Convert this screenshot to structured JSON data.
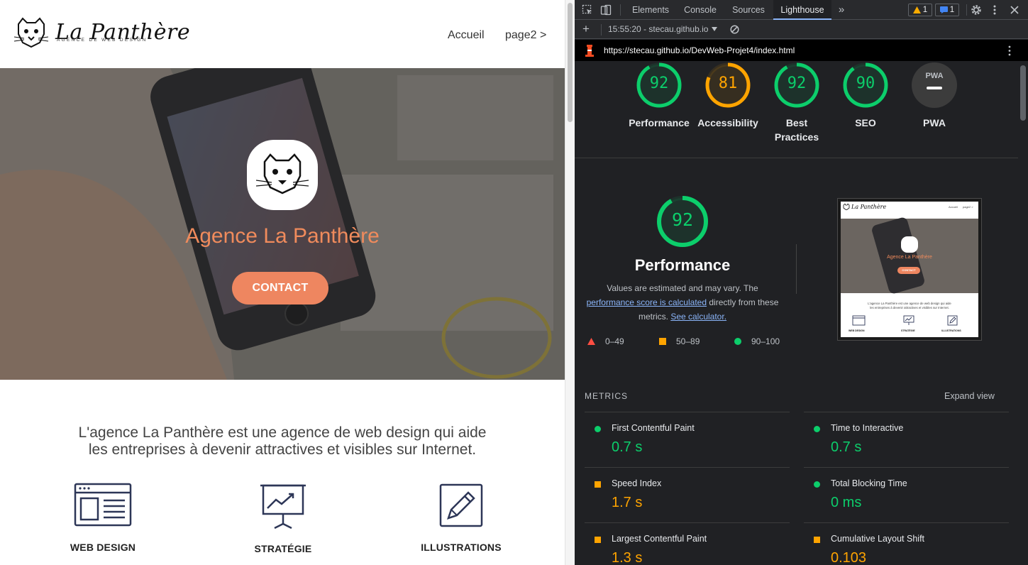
{
  "site": {
    "logo_name": "La Panthère",
    "logo_tagline": "AGENCE DE WEB DESIGN",
    "nav": [
      "Accueil",
      "page2 >"
    ],
    "hero_title": "Agence La Panthère",
    "contact_label": "CONTACT",
    "intro_line1": "L'agence La Panthère est une agence de web design qui aide",
    "intro_line2": "les entreprises à devenir attractives et visibles sur Internet.",
    "services": [
      "WEB DESIGN",
      "STRATÉGIE",
      "ILLUSTRATIONS"
    ]
  },
  "devtools": {
    "tabs": [
      "Elements",
      "Console",
      "Sources",
      "Lighthouse"
    ],
    "more_tabs": "»",
    "warning_count": "1",
    "message_count": "1",
    "toolbar_add": "+",
    "report_label": "15:55:20 - stecau.github.io",
    "report_url": "https://stecau.github.io/DevWeb-Projet4/index.html",
    "gauges": [
      {
        "score": "92",
        "label": "Performance",
        "level": 0.92,
        "status": "pass"
      },
      {
        "score": "81",
        "label": "Accessibility",
        "level": 0.81,
        "status": "average"
      },
      {
        "score": "92",
        "label": "Best Practices",
        "level": 0.92,
        "status": "pass"
      },
      {
        "score": "90",
        "label": "SEO",
        "level": 0.9,
        "status": "pass"
      },
      {
        "score": "",
        "label": "PWA",
        "level": 0,
        "status": "na",
        "badge": "PWA"
      }
    ],
    "perf_score": "92",
    "perf_level": 0.92,
    "perf_title": "Performance",
    "perf_desc_1": "Values are estimated and may vary. The",
    "perf_desc_link1": "performance score is calculated",
    "perf_desc_2": "directly from these",
    "perf_desc_3": "metrics.",
    "perf_desc_link2": "See calculator.",
    "legend": [
      "0–49",
      "50–89",
      "90–100"
    ],
    "thumb": {
      "title": "La Panthère",
      "nav": [
        "Accueil",
        "page2 >"
      ],
      "hero": "Agence La Panthère",
      "cta": "CONTACT",
      "intro_1": "L'agence La Panthère est une agence de web design qui aide",
      "intro_2": "les entreprises à devenir attractives et visibles sur Internet.",
      "services": [
        "WEB DESIGN",
        "STRATÉGIE",
        "ILLUSTRATIONS"
      ]
    },
    "metrics_heading": "METRICS",
    "expand_label": "Expand view",
    "metrics": [
      {
        "label": "First Contentful Paint",
        "value": "0.7 s",
        "status": "pass"
      },
      {
        "label": "Time to Interactive",
        "value": "0.7 s",
        "status": "pass"
      },
      {
        "label": "Speed Index",
        "value": "1.7 s",
        "status": "average"
      },
      {
        "label": "Total Blocking Time",
        "value": "0 ms",
        "status": "pass"
      },
      {
        "label": "Largest Contentful Paint",
        "value": "1.3 s",
        "status": "average"
      },
      {
        "label": "Cumulative Layout Shift",
        "value": "0.103",
        "status": "average"
      }
    ]
  },
  "colors": {
    "pass": "#0cce6b",
    "average": "#ffa400",
    "fail": "#ff4e42",
    "accent": "#ee8660",
    "link": "#8ab4f8"
  }
}
